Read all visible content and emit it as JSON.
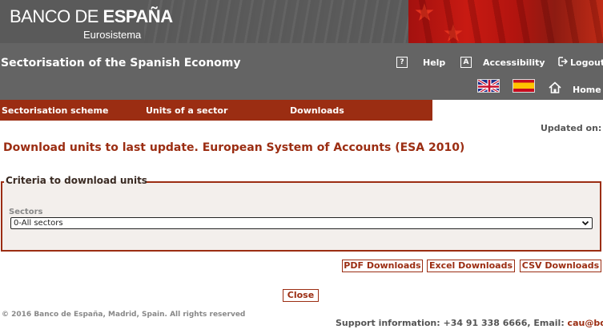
{
  "banner": {
    "logo_light": "BANCO DE ",
    "logo_bold": "ESPAÑA",
    "logo_sub": "Eurosistema"
  },
  "header": {
    "title": "Sectorisation of the Spanish Economy",
    "links": {
      "help": "Help",
      "help_icon_glyph": "?",
      "accessibility": "Accessibility",
      "accessibility_icon_glyph": "A",
      "logout": "Logout",
      "home": "Home"
    }
  },
  "nav": {
    "items": [
      "Sectorisation scheme",
      "Units of a sector",
      "Downloads"
    ]
  },
  "updated_label": "Updated on:",
  "page_title": "Download units to last update. European System of Accounts (ESA 2010)",
  "criteria": {
    "legend": "Criteria to download units",
    "sectors_label": "Sectors",
    "sectors_selected": "0-All sectors"
  },
  "buttons": {
    "pdf": "PDF Downloads",
    "excel": "Excel Downloads",
    "csv": "CSV Downloads",
    "close": "Close"
  },
  "footer": {
    "copyright": "© 2016 Banco de España, Madrid, Spain. All rights reserved",
    "support_text": "Support information: +34 91 338 6666, Email: ",
    "support_email": "cau@bde.es"
  },
  "colors": {
    "accent": "#9b2d12",
    "header_bg": "#646464",
    "banner_bg": "#5a5a5a"
  }
}
